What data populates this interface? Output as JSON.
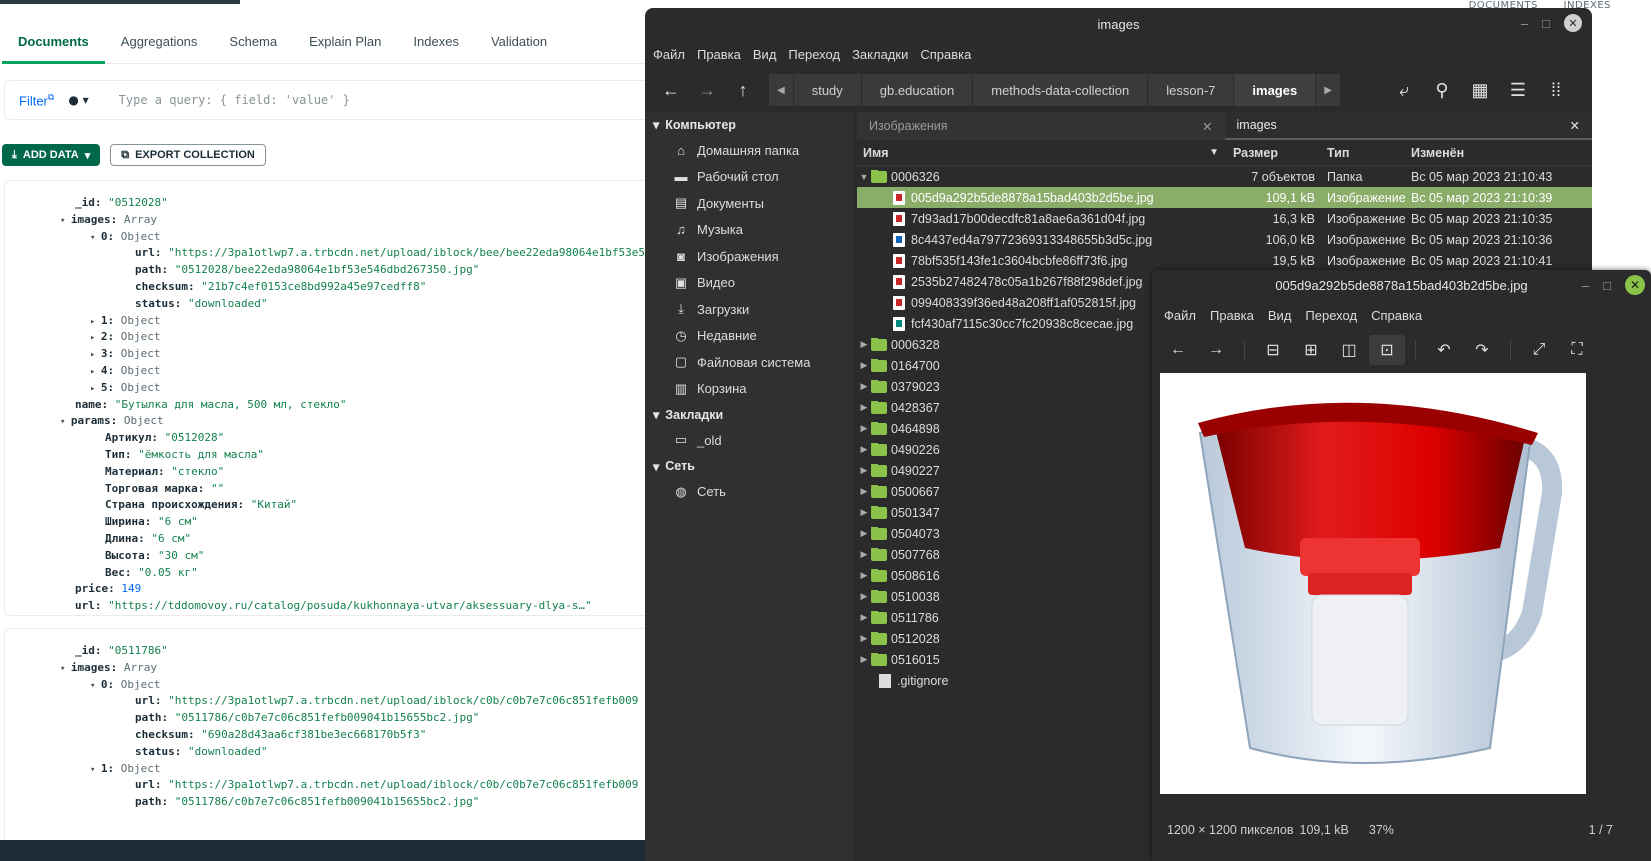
{
  "compass": {
    "top_labels": [
      "DOCUMENTS",
      "INDEXES"
    ],
    "tabs": [
      "Documents",
      "Aggregations",
      "Schema",
      "Explain Plan",
      "Indexes",
      "Validation"
    ],
    "filter_label": "Filter",
    "query_placeholder": "Type a query: { field: 'value' }",
    "add_data": "ADD DATA",
    "export_collection": "EXPORT COLLECTION",
    "doc1": [
      {
        "indent": 4,
        "arrow": "",
        "key": "_id:",
        "val": "\"0512028\"",
        "vt": "s"
      },
      {
        "indent": 3,
        "arrow": "▾",
        "key": "images:",
        "val": "Array",
        "vt": "t"
      },
      {
        "indent": 5,
        "arrow": "▾",
        "key": "0:",
        "val": "Object",
        "vt": "t"
      },
      {
        "indent": 8,
        "arrow": "",
        "key": "url:",
        "val": "\"https://3pa1otlwp7.a.trbcdn.net/upload/iblock/bee/bee22eda98064e1bf53e5",
        "vt": "s"
      },
      {
        "indent": 8,
        "arrow": "",
        "key": "path:",
        "val": "\"0512028/bee22eda98064e1bf53e546dbd267350.jpg\"",
        "vt": "s"
      },
      {
        "indent": 8,
        "arrow": "",
        "key": "checksum:",
        "val": "\"21b7c4ef0153ce8bd992a45e97cedff8\"",
        "vt": "s"
      },
      {
        "indent": 8,
        "arrow": "",
        "key": "status:",
        "val": "\"downloaded\"",
        "vt": "s"
      },
      {
        "indent": 5,
        "arrow": "▸",
        "key": "1:",
        "val": "Object",
        "vt": "t"
      },
      {
        "indent": 5,
        "arrow": "▸",
        "key": "2:",
        "val": "Object",
        "vt": "t"
      },
      {
        "indent": 5,
        "arrow": "▸",
        "key": "3:",
        "val": "Object",
        "vt": "t"
      },
      {
        "indent": 5,
        "arrow": "▸",
        "key": "4:",
        "val": "Object",
        "vt": "t"
      },
      {
        "indent": 5,
        "arrow": "▸",
        "key": "5:",
        "val": "Object",
        "vt": "t"
      },
      {
        "indent": 4,
        "arrow": "",
        "key": "name:",
        "val": "\"Бутылка для масла, 500 мл, стекло\"",
        "vt": "s"
      },
      {
        "indent": 3,
        "arrow": "▾",
        "key": "params:",
        "val": "Object",
        "vt": "t"
      },
      {
        "indent": 6,
        "arrow": "",
        "key": "Артикул:",
        "val": "\"0512028\"",
        "vt": "s"
      },
      {
        "indent": 6,
        "arrow": "",
        "key": "Тип:",
        "val": "\"ёмкость для масла\"",
        "vt": "s"
      },
      {
        "indent": 6,
        "arrow": "",
        "key": "Материал:",
        "val": "\"стекло\"",
        "vt": "s"
      },
      {
        "indent": 6,
        "arrow": "",
        "key": "Торговая марка:",
        "val": "\"\"",
        "vt": "s"
      },
      {
        "indent": 6,
        "arrow": "",
        "key": "Страна происхождения:",
        "val": "\"Китай\"",
        "vt": "s"
      },
      {
        "indent": 6,
        "arrow": "",
        "key": "Ширина:",
        "val": "\"6 см\"",
        "vt": "s"
      },
      {
        "indent": 6,
        "arrow": "",
        "key": "Длина:",
        "val": "\"6 см\"",
        "vt": "s"
      },
      {
        "indent": 6,
        "arrow": "",
        "key": "Высота:",
        "val": "\"30 см\"",
        "vt": "s"
      },
      {
        "indent": 6,
        "arrow": "",
        "key": "Вес:",
        "val": "\"0.05 кг\"",
        "vt": "s"
      },
      {
        "indent": 4,
        "arrow": "",
        "key": "price:",
        "val": "149",
        "vt": "n"
      },
      {
        "indent": 4,
        "arrow": "",
        "key": "url:",
        "val": "\"https://tddomovoy.ru/catalog/posuda/kukhonnaya-utvar/aksessuary-dlya-s…\"",
        "vt": "s"
      }
    ],
    "doc2": [
      {
        "indent": 4,
        "arrow": "",
        "key": "_id:",
        "val": "\"0511786\"",
        "vt": "s"
      },
      {
        "indent": 3,
        "arrow": "▾",
        "key": "images:",
        "val": "Array",
        "vt": "t"
      },
      {
        "indent": 5,
        "arrow": "▾",
        "key": "0:",
        "val": "Object",
        "vt": "t"
      },
      {
        "indent": 8,
        "arrow": "",
        "key": "url:",
        "val": "\"https://3pa1otlwp7.a.trbcdn.net/upload/iblock/c0b/c0b7e7c06c851fefb009",
        "vt": "s"
      },
      {
        "indent": 8,
        "arrow": "",
        "key": "path:",
        "val": "\"0511786/c0b7e7c06c851fefb009041b15655bc2.jpg\"",
        "vt": "s"
      },
      {
        "indent": 8,
        "arrow": "",
        "key": "checksum:",
        "val": "\"690a28d43aa6cf381be3ec668170b5f3\"",
        "vt": "s"
      },
      {
        "indent": 8,
        "arrow": "",
        "key": "status:",
        "val": "\"downloaded\"",
        "vt": "s"
      },
      {
        "indent": 5,
        "arrow": "▾",
        "key": "1:",
        "val": "Object",
        "vt": "t"
      },
      {
        "indent": 8,
        "arrow": "",
        "key": "url:",
        "val": "\"https://3pa1otlwp7.a.trbcdn.net/upload/iblock/c0b/c0b7e7c06c851fefb009",
        "vt": "s"
      },
      {
        "indent": 8,
        "arrow": "",
        "key": "path:",
        "val": "\"0511786/c0b7e7c06c851fefb009041b15655bc2.jpg\"",
        "vt": "s"
      }
    ]
  },
  "nemo": {
    "title": "images",
    "menu": [
      "Файл",
      "Правка",
      "Вид",
      "Переход",
      "Закладки",
      "Справка"
    ],
    "breadcrumbs": [
      "study",
      "gb.education",
      "methods-data-collection",
      "lesson-7",
      "images"
    ],
    "sidebar": [
      {
        "kind": "header",
        "label": "Компьютер"
      },
      {
        "kind": "item",
        "icon": "⌂",
        "label": "Домашняя папка"
      },
      {
        "kind": "item",
        "icon": "▬",
        "label": "Рабочий стол"
      },
      {
        "kind": "item",
        "icon": "▤",
        "label": "Документы"
      },
      {
        "kind": "item",
        "icon": "♫",
        "label": "Музыка"
      },
      {
        "kind": "item",
        "icon": "◙",
        "label": "Изображения"
      },
      {
        "kind": "item",
        "icon": "▣",
        "label": "Видео"
      },
      {
        "kind": "item",
        "icon": "⤓",
        "label": "Загрузки"
      },
      {
        "kind": "item",
        "icon": "◷",
        "label": "Недавние"
      },
      {
        "kind": "item",
        "icon": "▢",
        "label": "Файловая система"
      },
      {
        "kind": "item",
        "icon": "▥",
        "label": "Корзина"
      },
      {
        "kind": "header",
        "label": "Закладки"
      },
      {
        "kind": "item",
        "icon": "▭",
        "label": "_old"
      },
      {
        "kind": "header",
        "label": "Сеть"
      },
      {
        "kind": "item",
        "icon": "◍",
        "label": "Сеть"
      }
    ],
    "pane_tabs": [
      "Изображения",
      "images"
    ],
    "columns": {
      "name": "Имя",
      "size": "Размер",
      "type": "Тип",
      "modified": "Изменён"
    },
    "rows": [
      {
        "kind": "folder-open",
        "name": "0006326",
        "size": "7 объектов",
        "type": "Папка",
        "mod": "Вс 05 мар 2023 21:10:43"
      },
      {
        "kind": "image",
        "color": "#c62828",
        "name": "005d9a292b5de8878a15bad403b2d5be.jpg",
        "size": "109,1 kB",
        "type": "Изображение",
        "mod": "Вс 05 мар 2023 21:10:39",
        "selected": true
      },
      {
        "kind": "image",
        "color": "#c62828",
        "name": "7d93ad17b00decdfc81a8ae6a361d04f.jpg",
        "size": "16,3 kB",
        "type": "Изображение",
        "mod": "Вс 05 мар 2023 21:10:35"
      },
      {
        "kind": "image",
        "color": "#1565c0",
        "name": "8c4437ed4a79772369313348655b3d5c.jpg",
        "size": "106,0 kB",
        "type": "Изображение",
        "mod": "Вс 05 мар 2023 21:10:36"
      },
      {
        "kind": "image",
        "color": "#c62828",
        "name": "78bf535f143fe1c3604bcbfe86ff73f6.jpg",
        "size": "19,5 kB",
        "type": "Изображение",
        "mod": "Вс 05 мар 2023 21:10:41"
      },
      {
        "kind": "image",
        "color": "#c62828",
        "name": "2535b27482478c05a1b267f88f298def.jpg",
        "size": "",
        "type": "",
        "mod": ""
      },
      {
        "kind": "image",
        "color": "#c62828",
        "name": "099408339f36ed48a208ff1af052815f.jpg",
        "size": "",
        "type": "",
        "mod": ""
      },
      {
        "kind": "image",
        "color": "#00897b",
        "name": "fcf430af7115c30cc7fc20938c8cecae.jpg",
        "size": "",
        "type": "",
        "mod": ""
      },
      {
        "kind": "folder",
        "name": "0006328"
      },
      {
        "kind": "folder",
        "name": "0164700"
      },
      {
        "kind": "folder",
        "name": "0379023"
      },
      {
        "kind": "folder",
        "name": "0428367"
      },
      {
        "kind": "folder",
        "name": "0464898"
      },
      {
        "kind": "folder",
        "name": "0490226"
      },
      {
        "kind": "folder",
        "name": "0490227"
      },
      {
        "kind": "folder",
        "name": "0500667"
      },
      {
        "kind": "folder",
        "name": "0501347"
      },
      {
        "kind": "folder",
        "name": "0504073"
      },
      {
        "kind": "folder",
        "name": "0507768"
      },
      {
        "kind": "folder",
        "name": "0508616"
      },
      {
        "kind": "folder",
        "name": "0510038"
      },
      {
        "kind": "folder",
        "name": "0511786"
      },
      {
        "kind": "folder",
        "name": "0512028"
      },
      {
        "kind": "folder",
        "name": "0516015"
      },
      {
        "kind": "file",
        "name": ".gitignore"
      }
    ]
  },
  "viewer": {
    "title": "005d9a292b5de8878a15bad403b2d5be.jpg",
    "menu": [
      "Файл",
      "Правка",
      "Вид",
      "Переход",
      "Справка"
    ],
    "status_dims": "1200 × 1200 пикселов",
    "status_size": "109,1 kB",
    "status_zoom": "37%",
    "status_pos": "1 / 7"
  }
}
